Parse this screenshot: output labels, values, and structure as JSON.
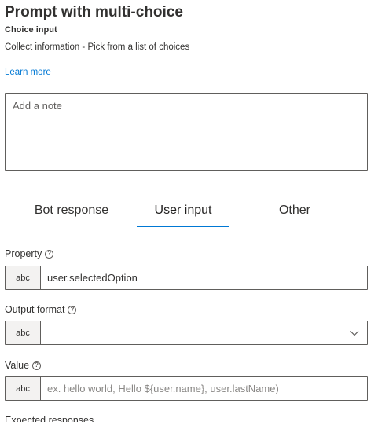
{
  "header": {
    "title": "Prompt with multi-choice",
    "subtitle": "Choice input",
    "description": "Collect information - Pick from a list of choices",
    "learn_more": "Learn more"
  },
  "note": {
    "placeholder": "Add a note",
    "value": ""
  },
  "tabs": [
    {
      "label": "Bot response",
      "selected": false
    },
    {
      "label": "User input",
      "selected": true
    },
    {
      "label": "Other",
      "selected": false
    }
  ],
  "fields": {
    "property": {
      "label": "Property",
      "type_tag": "abc",
      "value": "user.selectedOption",
      "placeholder": ""
    },
    "output_format": {
      "label": "Output format",
      "type_tag": "abc",
      "selected": ""
    },
    "value": {
      "label": "Value",
      "type_tag": "abc",
      "value": "",
      "placeholder": "ex. hello world, Hello ${user.name}, user.lastName)"
    },
    "expected_responses": {
      "label": "Expected responses"
    }
  },
  "icons": {
    "help": "help-circle-icon",
    "dropdown": "chevron-down-icon"
  },
  "colors": {
    "accent": "#0078d4",
    "text": "#323130",
    "border": "#605e5c",
    "tag_bg": "#f3f2f1"
  }
}
